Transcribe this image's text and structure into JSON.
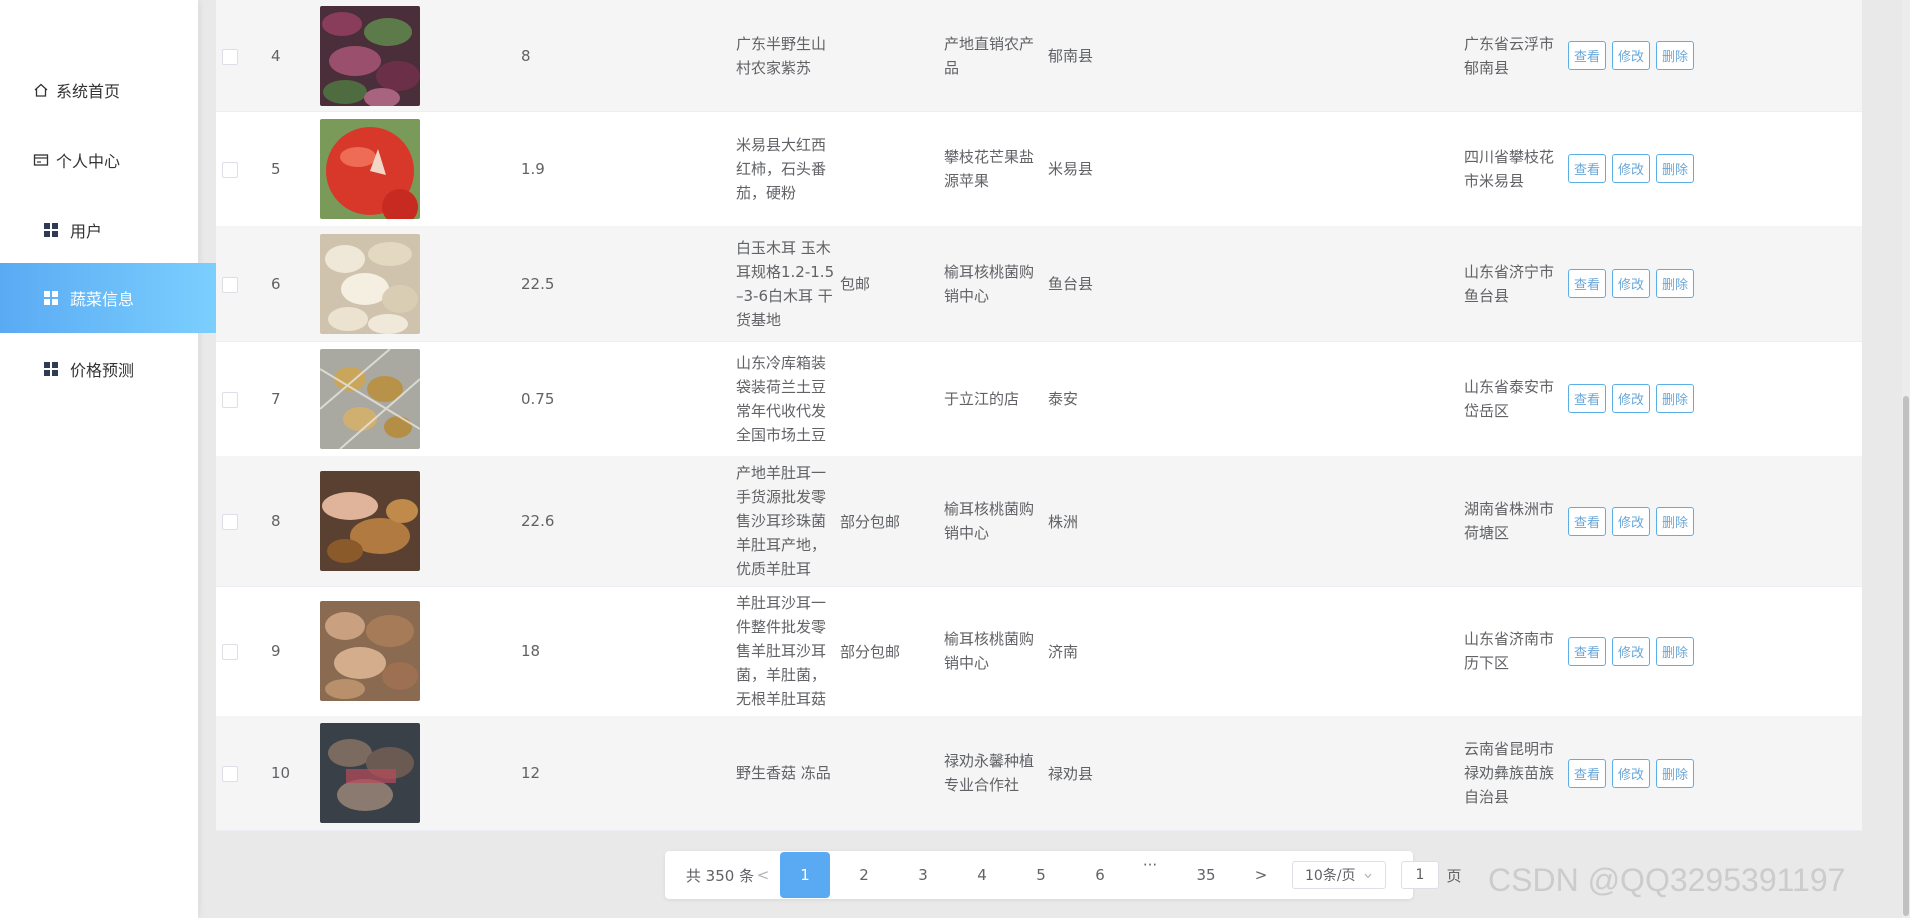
{
  "sidebar": {
    "items": [
      {
        "label": "系统首页",
        "icon": "home-icon"
      },
      {
        "label": "个人中心",
        "icon": "id-card-icon"
      },
      {
        "label": "用户",
        "icon": "grid-icon"
      },
      {
        "label": "蔬菜信息",
        "icon": "grid-icon",
        "active": true
      },
      {
        "label": "价格预测",
        "icon": "grid-icon"
      }
    ]
  },
  "table": {
    "rows": [
      {
        "idx": "4",
        "price": "8",
        "name": "广东半野生山\n村农家紫苏",
        "shipping": "",
        "shop": "产地直销农产\n品",
        "origin": "郁南县",
        "address": "广东省云浮市\n郁南县",
        "img": "purple-leaf-vegetable"
      },
      {
        "idx": "5",
        "price": "1.9",
        "name": "米易县大红西\n红柿，石头番\n茄，硬粉",
        "shipping": "",
        "shop": "攀枝花芒果盐\n源苹果",
        "origin": "米易县",
        "address": "四川省攀枝花\n市米易县",
        "img": "red-tomato"
      },
      {
        "idx": "6",
        "price": "22.5",
        "name": "白玉木耳 玉木\n耳规格1.2-1.5\n–3-6白木耳 干\n货基地",
        "shipping": "包邮",
        "shop": "榆耳核桃菌购\n销中心",
        "origin": "鱼台县",
        "address": "山东省济宁市\n鱼台县",
        "img": "white-fungus"
      },
      {
        "idx": "7",
        "price": "0.75",
        "name": "山东冷库箱装\n袋装荷兰土豆\n常年代收代发\n全国市场土豆",
        "shipping": "",
        "shop": "于立江的店",
        "origin": "泰安",
        "address": "山东省泰安市\n岱岳区",
        "img": "potatoes-in-net"
      },
      {
        "idx": "8",
        "price": "22.6",
        "name": "产地羊肚耳一\n手货源批发零\n售沙耳珍珠菌\n羊肚耳产地，\n优质羊肚耳",
        "shipping": "部分包邮",
        "shop": "榆耳核桃菌购\n销中心",
        "origin": "株洲",
        "address": "湖南省株洲市\n荷塘区",
        "img": "dried-fungus-hand"
      },
      {
        "idx": "9",
        "price": "18",
        "name": "羊肚耳沙耳一\n件整件批发零\n售羊肚耳沙耳\n菌，羊肚菌，\n无根羊肚耳菇",
        "shipping": "部分包邮",
        "shop": "榆耳核桃菌购\n销中心",
        "origin": "济南",
        "address": "山东省济南市\n历下区",
        "img": "dried-fungus-pile"
      },
      {
        "idx": "10",
        "price": "12",
        "name": "野生香菇 冻品",
        "shipping": "",
        "shop": "禄劝永馨种植\n专业合作社",
        "origin": "禄劝县",
        "address": "云南省昆明市\n禄劝彝族苗族\n自治县",
        "img": "frozen-mushrooms"
      }
    ],
    "ops": {
      "view": "查看",
      "edit": "修改",
      "delete": "删除"
    }
  },
  "pagination": {
    "total": "共 350 条",
    "prev": "<",
    "pages": [
      "1",
      "2",
      "3",
      "4",
      "5",
      "6"
    ],
    "current": "1",
    "ellipsis": "···",
    "last": "35",
    "next": ">",
    "page_size": "10条/页",
    "goto_value": "1",
    "goto_suffix": "页"
  },
  "watermark": "CSDN @QQ3295391197",
  "colors": {
    "accent": "#5aaaf3",
    "button_border": "#5ab0e6"
  }
}
